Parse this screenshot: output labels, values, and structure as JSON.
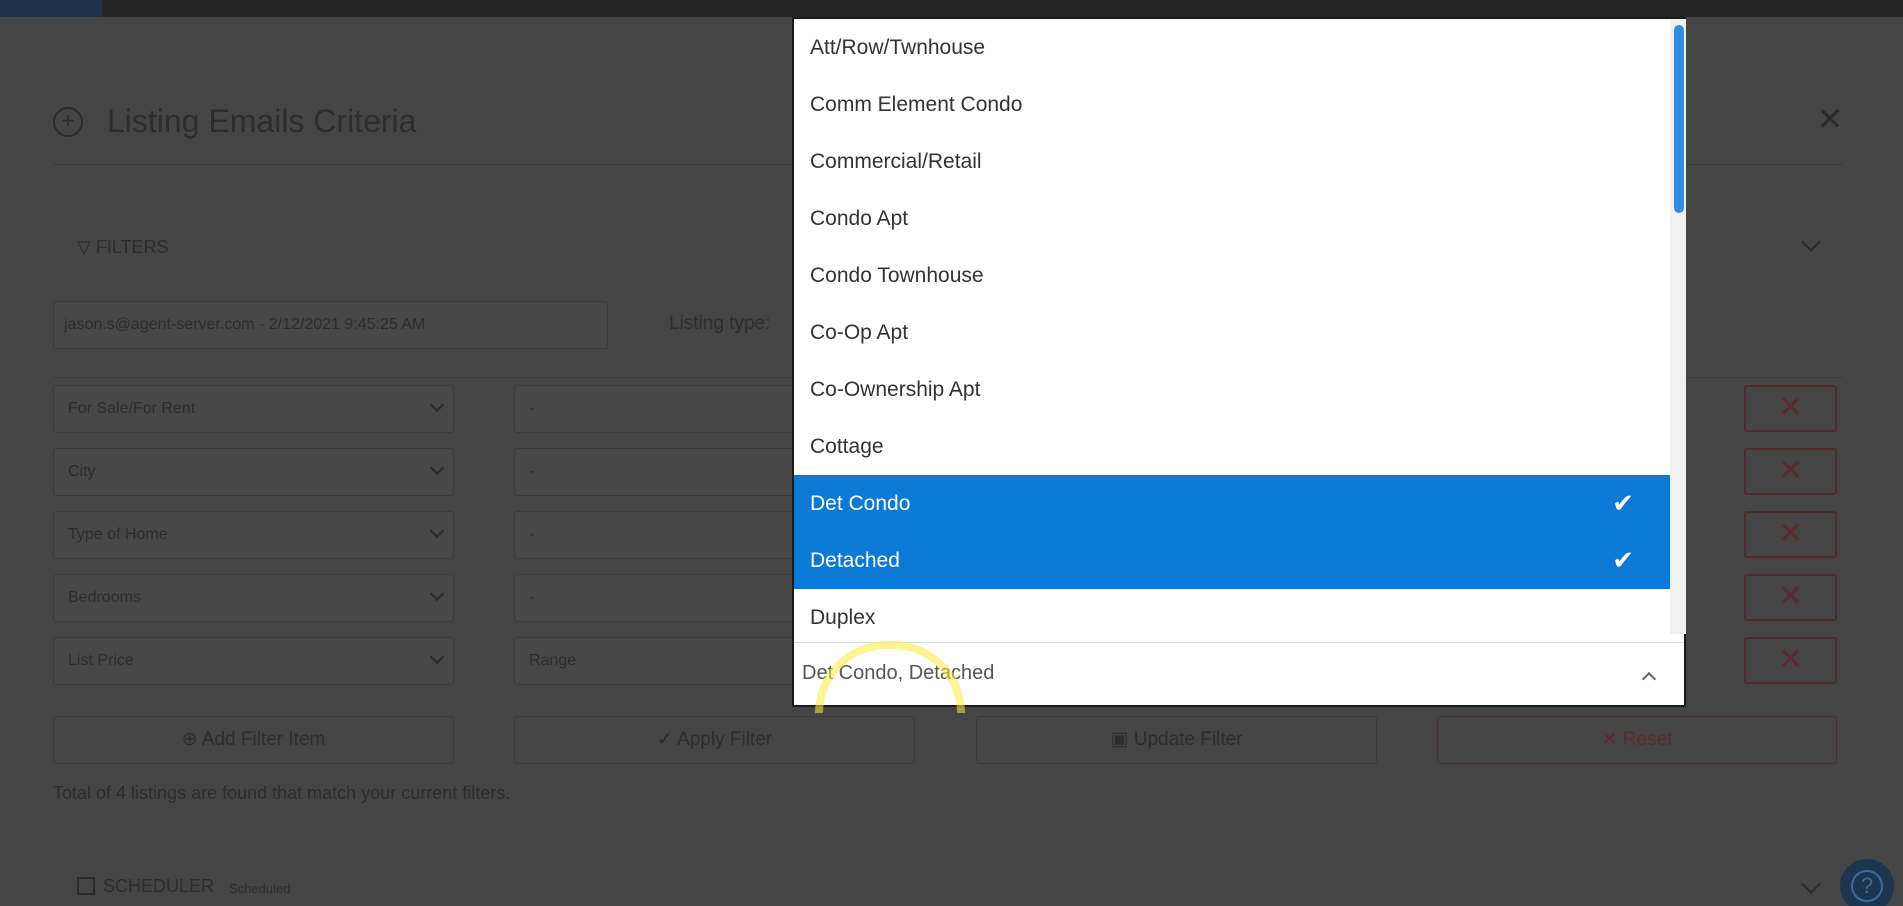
{
  "header": {
    "title": "Listing Emails Criteria"
  },
  "filters": {
    "label": "FILTERS"
  },
  "saved_filter": {
    "value": "jason.s@agent-server.com - 2/12/2021 9:45:25 AM"
  },
  "listing_type": {
    "label": "Listing type:"
  },
  "filter_rows": [
    {
      "field": "For Sale/For Rent",
      "value": "-"
    },
    {
      "field": "City",
      "value": "-"
    },
    {
      "field": "Type of Home",
      "value": "-"
    },
    {
      "field": "Bedrooms",
      "value": "-"
    },
    {
      "field": "List Price",
      "value": "Range"
    }
  ],
  "actions": {
    "add": "Add Filter Item",
    "apply": "Apply Filter",
    "update": "Update Filter",
    "reset": "Reset"
  },
  "total_text": "Total of 4 listings are found that match your current filters.",
  "scheduler": {
    "label": "SCHEDULER",
    "sub": "Scheduled"
  },
  "dropdown": {
    "options": [
      {
        "label": "Att/Row/Twnhouse",
        "selected": false
      },
      {
        "label": "Comm Element Condo",
        "selected": false
      },
      {
        "label": "Commercial/Retail",
        "selected": false
      },
      {
        "label": "Condo Apt",
        "selected": false
      },
      {
        "label": "Condo Townhouse",
        "selected": false
      },
      {
        "label": "Co-Op Apt",
        "selected": false
      },
      {
        "label": "Co-Ownership Apt",
        "selected": false
      },
      {
        "label": "Cottage",
        "selected": false
      },
      {
        "label": "Det Condo",
        "selected": true
      },
      {
        "label": "Detached",
        "selected": true
      },
      {
        "label": "Duplex",
        "selected": false
      }
    ],
    "selected_value": "Det Condo, Detached"
  },
  "colors": {
    "accent": "#0a7ad6",
    "overlay": "#454545",
    "danger": "#5a2c2c"
  },
  "icons": {
    "header": "plus-circle-icon",
    "close": "close-icon",
    "filter": "filter-icon",
    "check": "check-icon",
    "help": "help-icon"
  }
}
